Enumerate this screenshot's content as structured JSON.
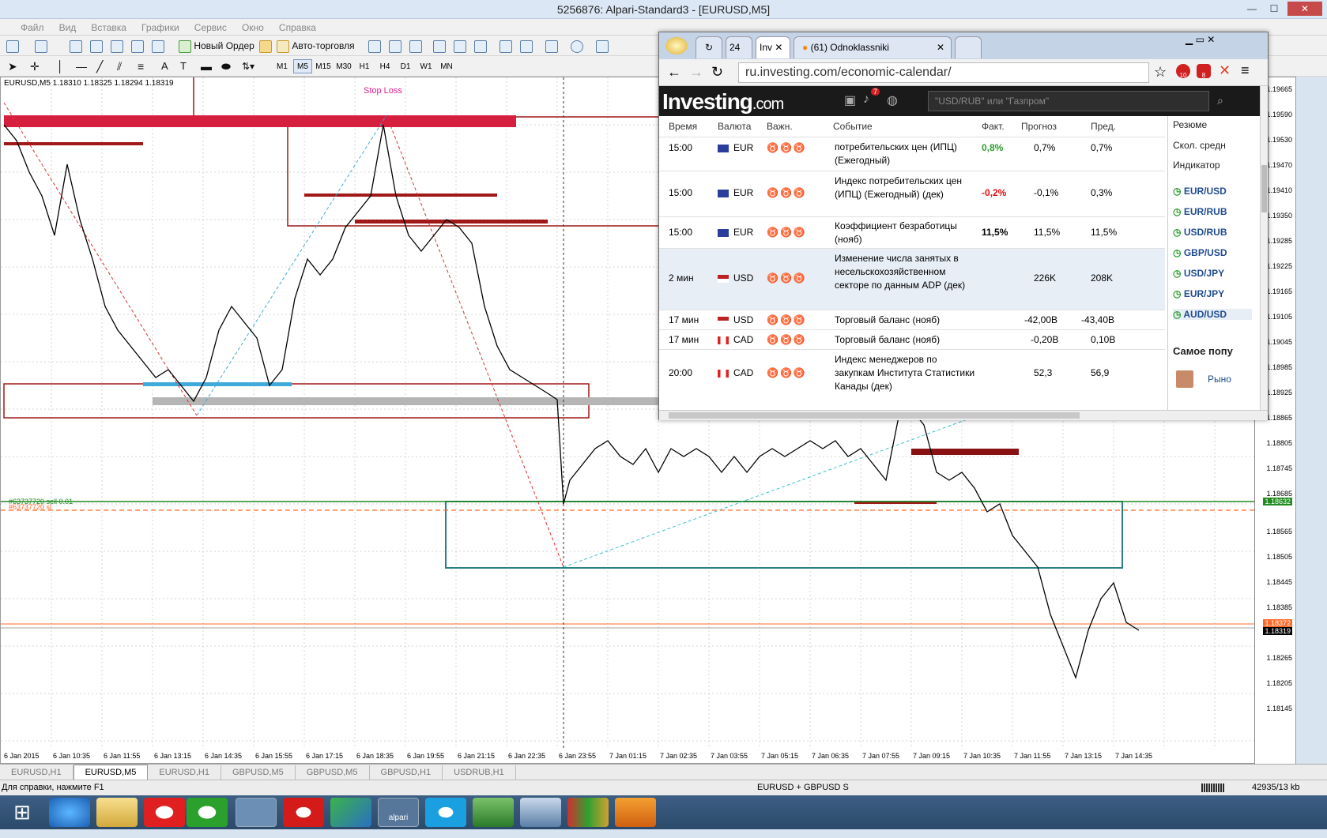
{
  "window": {
    "title": "5256876: Alpari-Standard3 - [EURUSD,M5]"
  },
  "menu": [
    "Файл",
    "Вид",
    "Вставка",
    "Графики",
    "Сервис",
    "Окно",
    "Справка"
  ],
  "toolbar": {
    "new_order": "Новый Ордер",
    "auto_trading": "Авто-торговля"
  },
  "timeframes": [
    "M1",
    "M5",
    "M15",
    "M30",
    "H1",
    "H4",
    "D1",
    "W1",
    "MN"
  ],
  "chart": {
    "header": "EURUSD,M5  1.18310 1.18325 1.18294 1.18319",
    "stop_loss_label": "Stop Loss",
    "order_labels": [
      "#63737720 sell 0.01",
      "#63737720 sl"
    ],
    "current_price": "1.18319",
    "green_line_price": "1.18632",
    "orange_price": "1.18372",
    "price_levels": [
      "1.19665",
      "1.19590",
      "1.19530",
      "1.19470",
      "1.19410",
      "1.19350",
      "1.19285",
      "1.19225",
      "1.19165",
      "1.19105",
      "1.19045",
      "1.18985",
      "1.18925",
      "1.18865",
      "1.18805",
      "1.18745",
      "1.18685",
      "1.18625",
      "1.18565",
      "1.18505",
      "1.18445",
      "1.18385",
      "1.18325",
      "1.18265",
      "1.18205",
      "1.18145"
    ],
    "time_labels": [
      "6 Jan 2015",
      "6 Jan 10:35",
      "6 Jan 11:55",
      "6 Jan 13:15",
      "6 Jan 14:35",
      "6 Jan 15:55",
      "6 Jan 17:15",
      "6 Jan 18:35",
      "6 Jan 19:55",
      "6 Jan 21:15",
      "6 Jan 22:35",
      "6 Jan 23:55",
      "7 Jan 01:15",
      "7 Jan 02:35",
      "7 Jan 03:55",
      "7 Jan 05:15",
      "7 Jan 06:35",
      "7 Jan 07:55",
      "7 Jan 09:15",
      "7 Jan 10:35",
      "7 Jan 11:55",
      "7 Jan 13:15",
      "7 Jan 14:35"
    ]
  },
  "chart_tabs": [
    "EURUSD,H1",
    "EURUSD,M5",
    "EURUSD,H1",
    "GBPUSD,M5",
    "GBPUSD,M5",
    "GBPUSD,H1",
    "USDRUB,H1"
  ],
  "status": {
    "help": "Для справки, нажмите F1",
    "profile": "EURUSD + GBPUSD S",
    "traffic": "42935/13 kb"
  },
  "browser": {
    "tabs": [
      "24",
      "Inv",
      "(61) Odnoklassniki"
    ],
    "url": "ru.investing.com/economic-calendar/",
    "badges": {
      "bell": "7",
      "ext1": "10",
      "abp": "8"
    },
    "search_placeholder": "\"USD/RUB\" или \"Газпром\"",
    "logo_main": "Investing",
    "logo_dot": ".com",
    "columns": [
      "Время",
      "Валюта",
      "Важн.",
      "Событие",
      "Факт.",
      "Прогноз",
      "Пред."
    ],
    "rows": [
      {
        "time": "15:00",
        "cur": "EUR",
        "event": "потребительских цен (ИПЦ) (Ежегодный)",
        "actual": "0,8%",
        "actual_color": "#2a9d2a",
        "forecast": "0,7%",
        "prev": "0,7%"
      },
      {
        "time": "15:00",
        "cur": "EUR",
        "event": "Индекс потребительских цен (ИПЦ) (Ежегодный) (дек)",
        "actual": "-0,2%",
        "actual_color": "#d11",
        "forecast": "-0,1%",
        "prev": "0,3%"
      },
      {
        "time": "15:00",
        "cur": "EUR",
        "event": "Коэффициент безработицы (нояб)",
        "actual": "11,5%",
        "actual_color": "#000",
        "forecast": "11,5%",
        "prev": "11,5%"
      },
      {
        "time": "2 мин",
        "cur": "USD",
        "event": "Изменение числа занятых в несельскохозяйственном секторе по данным ADP (дек)",
        "actual": "",
        "actual_color": "#000",
        "forecast": "226K",
        "prev": "208K"
      },
      {
        "time": "17 мин",
        "cur": "USD",
        "event": "Торговый баланс (нояб)",
        "actual": "",
        "actual_color": "#000",
        "forecast": "-42,00B",
        "prev": "-43,40B"
      },
      {
        "time": "17 мин",
        "cur": "CAD",
        "event": "Торговый баланс (нояб)",
        "actual": "",
        "actual_color": "#000",
        "forecast": "-0,20B",
        "prev": "0,10B"
      },
      {
        "time": "20:00",
        "cur": "CAD",
        "event": "Индекс менеджеров по закупкам Института Статистики Канады (дек)",
        "actual": "",
        "actual_color": "#000",
        "forecast": "52,3",
        "prev": "56,9"
      }
    ],
    "side_links": [
      "Резюме",
      "Скол. средн",
      "Индикатор"
    ],
    "side_pairs": [
      "EUR/USD",
      "EUR/RUB",
      "USD/RUB",
      "GBP/USD",
      "USD/JPY",
      "EUR/JPY",
      "AUD/USD"
    ],
    "popular_title": "Самое попу",
    "popular_item": "Рыно"
  },
  "taskbar": {
    "alpari_label": "alpari"
  }
}
